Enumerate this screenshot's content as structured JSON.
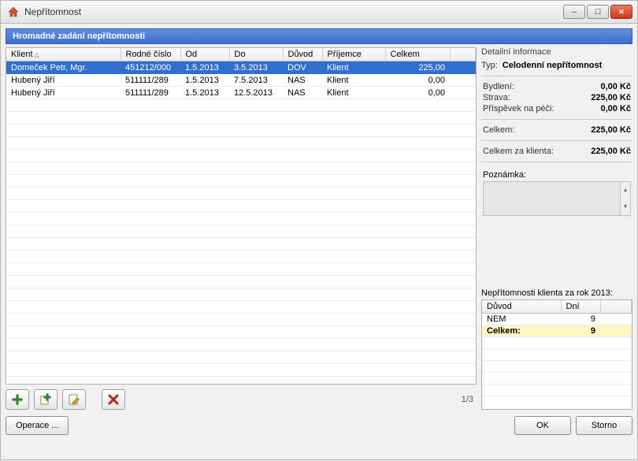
{
  "window": {
    "title": "Nepřítomnost"
  },
  "section": {
    "title": "Hromadné zadání nepřítomnosti"
  },
  "table": {
    "columns": {
      "klient": "Klient",
      "rc": "Rodné číslo",
      "od": "Od",
      "do": "Do",
      "duvod": "Důvod",
      "prijemce": "Příjemce",
      "celkem": "Celkem"
    },
    "rows": [
      {
        "klient": "Domeček Petr, Mgr.",
        "rc": "451212/000",
        "od": "1.5.2013",
        "do": "3.5.2013",
        "duvod": "DOV",
        "prijemce": "Klient",
        "celkem": "225,00"
      },
      {
        "klient": "Hubený Jiří",
        "rc": "511111/289",
        "od": "1.5.2013",
        "do": "7.5.2013",
        "duvod": "NAS",
        "prijemce": "Klient",
        "celkem": "0,00"
      },
      {
        "klient": "Hubený Jiří",
        "rc": "511111/289",
        "od": "1.5.2013",
        "do": "12.5.2013",
        "duvod": "NAS",
        "prijemce": "Klient",
        "celkem": "0,00"
      }
    ],
    "counter": "1/3"
  },
  "detail": {
    "heading": "Detailní informace",
    "typ_label": "Typ:",
    "typ_value": "Celodenní nepřítomnost",
    "bydleni_label": "Bydlení:",
    "bydleni_value": "0,00 Kč",
    "strava_label": "Strava:",
    "strava_value": "225,00 Kč",
    "prispevek_label": "Příspěvek na péči:",
    "prispevek_value": "0,00 Kč",
    "celkem_label": "Celkem:",
    "celkem_value": "225,00 Kč",
    "celkem_klient_label": "Celkem za klienta:",
    "celkem_klient_value": "225,00 Kč",
    "poznamka_label": "Poznámka:"
  },
  "mini": {
    "heading": "Nepřítomnosti klienta za rok 2013:",
    "col_duvod": "Důvod",
    "col_dni": "Dní",
    "row1_duvod": "NEM",
    "row1_dni": "9",
    "total_label": "Celkem:",
    "total_value": "9"
  },
  "buttons": {
    "operace": "Operace ...",
    "ok": "OK",
    "storno": "Storno"
  }
}
